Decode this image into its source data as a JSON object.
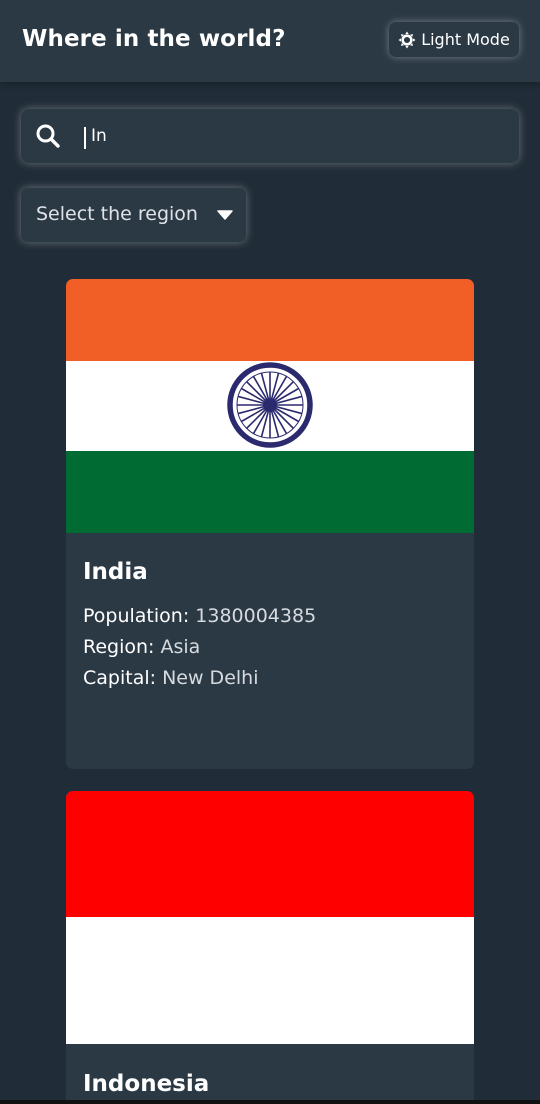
{
  "header": {
    "title": "Where in the world?",
    "mode_button_label": "Light Mode"
  },
  "search": {
    "value": "In"
  },
  "filter": {
    "selected": "Select the region"
  },
  "countries": [
    {
      "name": "India",
      "population_label": "Population:",
      "population": "1380004385",
      "region_label": "Region:",
      "region": "Asia",
      "capital_label": "Capital:",
      "capital": "New Delhi",
      "flag_colors": [
        "#f15f27",
        "#ffffff",
        "#006b33",
        "#2b2a6e"
      ]
    },
    {
      "name": "Indonesia",
      "flag_colors": [
        "#ff0000",
        "#ffffff"
      ]
    }
  ],
  "icons": {
    "mode": "sun-icon",
    "search": "search-icon",
    "region_caret": "caret-down-icon"
  },
  "colors": {
    "background": "#202c37",
    "elements": "#2b3945",
    "text": "#ffffff"
  }
}
